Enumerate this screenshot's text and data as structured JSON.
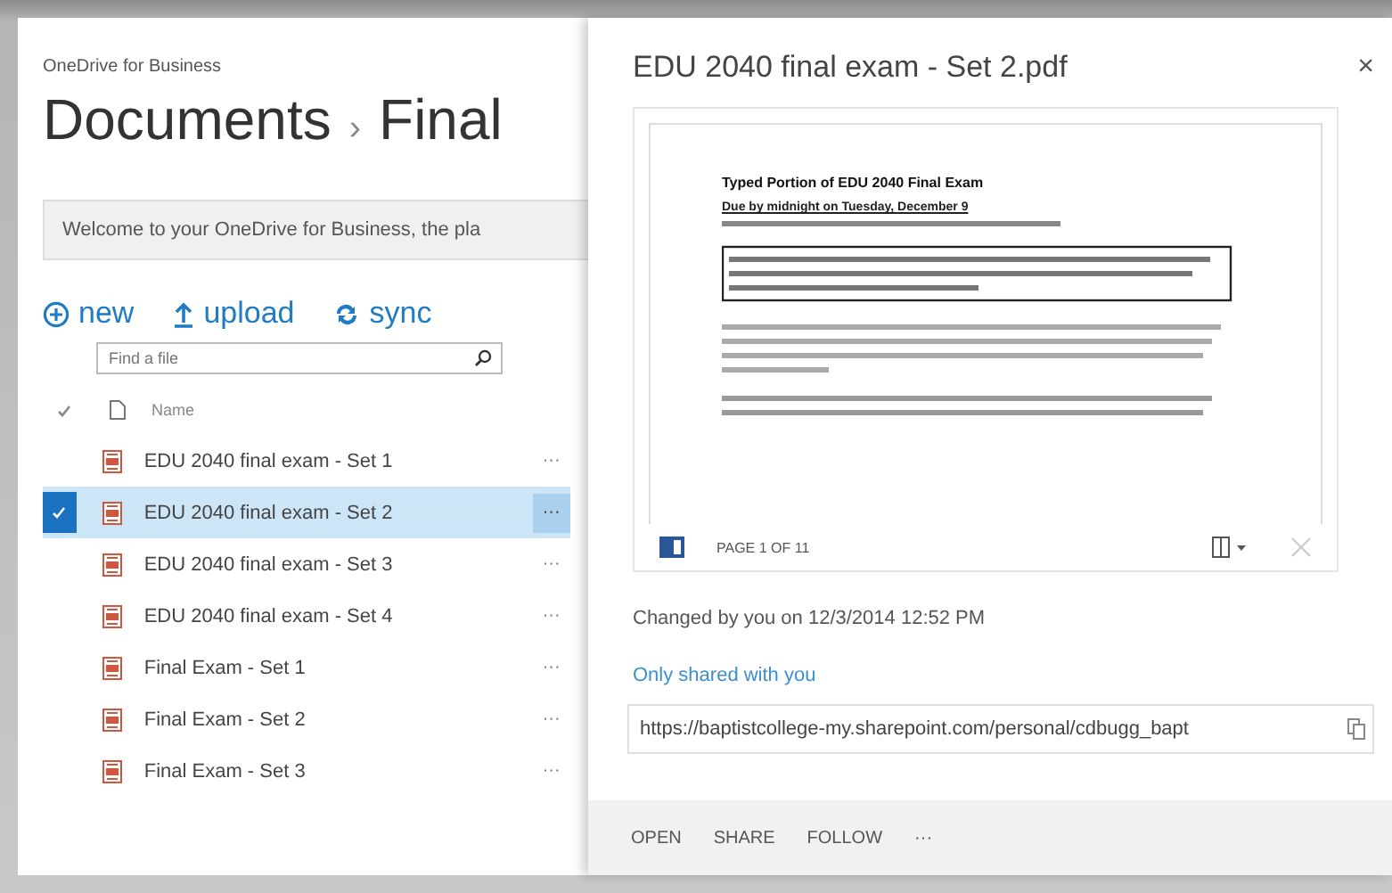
{
  "app": {
    "name": "OneDrive for Business"
  },
  "breadcrumb": {
    "root": "Documents",
    "separator": "›",
    "current": "Final"
  },
  "banner": {
    "text": "Welcome to your OneDrive for Business, the pla"
  },
  "commands": [
    {
      "kind": "new",
      "label": "new"
    },
    {
      "kind": "upload",
      "label": "upload"
    },
    {
      "kind": "sync",
      "label": "sync"
    }
  ],
  "search": {
    "placeholder": "Find a file"
  },
  "table": {
    "columns": [
      "Name"
    ],
    "rows": [
      {
        "name": "EDU 2040 final exam - Set 1",
        "selected": false,
        "more": "···"
      },
      {
        "name": "EDU 2040 final exam - Set 2",
        "selected": true,
        "more": "···"
      },
      {
        "name": "EDU 2040 final exam - Set 3",
        "selected": false,
        "more": "···"
      },
      {
        "name": "EDU 2040 final exam - Set 4",
        "selected": false,
        "more": "···"
      },
      {
        "name": "Final Exam - Set 1",
        "selected": false,
        "more": "···"
      },
      {
        "name": "Final Exam - Set 2",
        "selected": false,
        "more": "···"
      },
      {
        "name": "Final Exam - Set 3",
        "selected": false,
        "more": "···"
      }
    ]
  },
  "callout": {
    "title": "EDU 2040 final exam - Set 2.pdf",
    "close": "×",
    "preview": {
      "heading": "Typed Portion of EDU 2040 Final Exam",
      "due": "Due by midnight on Tuesday, December 9",
      "page": "PAGE 1 OF 11"
    },
    "changed": "Changed by you on 12/3/2014 12:52 PM",
    "sharing": "Only shared with you",
    "url": "https://baptistcollege-my.sharepoint.com/personal/cdbugg_bapt",
    "actions": [
      "OPEN",
      "SHARE",
      "FOLLOW",
      "···"
    ]
  }
}
